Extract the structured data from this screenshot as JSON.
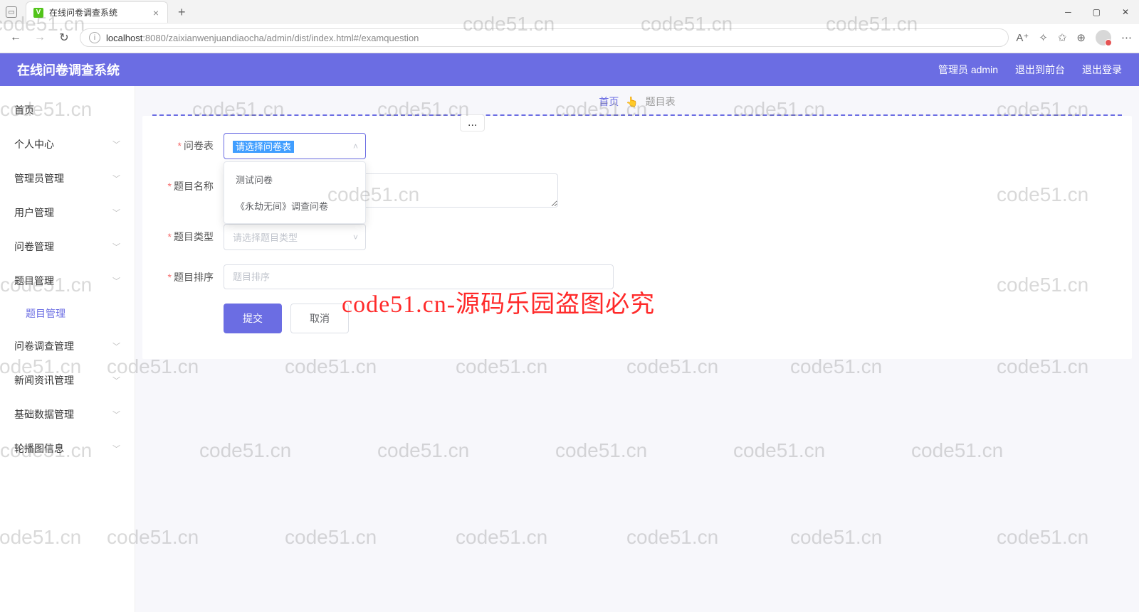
{
  "browser": {
    "tab_title": "在线问卷调查系统",
    "url_host": "localhost",
    "url_port": ":8080",
    "url_path": "/zaixianwenjuandiaocha/admin/dist/index.html#/examquestion"
  },
  "header": {
    "app_title": "在线问卷调查系统",
    "user_label": "管理员 admin",
    "back_front": "退出到前台",
    "logout": "退出登录"
  },
  "sidebar": {
    "items": [
      {
        "label": "首页",
        "expandable": false
      },
      {
        "label": "个人中心",
        "expandable": true
      },
      {
        "label": "管理员管理",
        "expandable": true
      },
      {
        "label": "用户管理",
        "expandable": true
      },
      {
        "label": "问卷管理",
        "expandable": true
      },
      {
        "label": "题目管理",
        "expandable": true,
        "children": [
          {
            "label": "题目管理"
          }
        ]
      },
      {
        "label": "问卷调查管理",
        "expandable": true
      },
      {
        "label": "新闻资讯管理",
        "expandable": true
      },
      {
        "label": "基础数据管理",
        "expandable": true
      },
      {
        "label": "轮播图信息",
        "expandable": true
      }
    ]
  },
  "breadcrumb": {
    "home": "首页",
    "separator": "👆",
    "current": "题目表"
  },
  "more_button": "...",
  "form": {
    "fields": {
      "paper": {
        "label": "问卷表",
        "placeholder": "请选择问卷表"
      },
      "name": {
        "label": "题目名称",
        "placeholder": ""
      },
      "type": {
        "label": "题目类型",
        "placeholder": "请选择题目类型"
      },
      "order": {
        "label": "题目排序",
        "placeholder": "题目排序"
      }
    },
    "dropdown_options": [
      "测试问卷",
      "《永劫无间》调查问卷"
    ],
    "submit": "提交",
    "cancel": "取消"
  },
  "watermark": {
    "text": "code51.cn",
    "red_text": "code51.cn-源码乐园盗图必究"
  }
}
